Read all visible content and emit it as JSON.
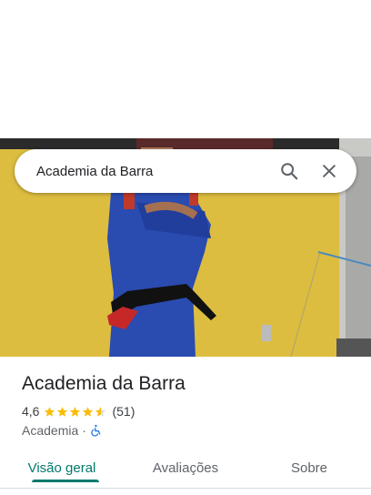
{
  "search": {
    "query": "Academia da Barra"
  },
  "place": {
    "name": "Academia da Barra",
    "rating": "4,6",
    "rating_value": 4.6,
    "review_count": "(51)",
    "category": "Academia",
    "separator": "·",
    "accessibility_icon": "wheelchair-icon"
  },
  "tabs": [
    {
      "label": "Visão geral",
      "active": true
    },
    {
      "label": "Avaliações",
      "active": false
    },
    {
      "label": "Sobre",
      "active": false
    }
  ],
  "colors": {
    "accent": "#00796b",
    "star": "#fbbc04",
    "accessibility": "#1a73e8"
  }
}
